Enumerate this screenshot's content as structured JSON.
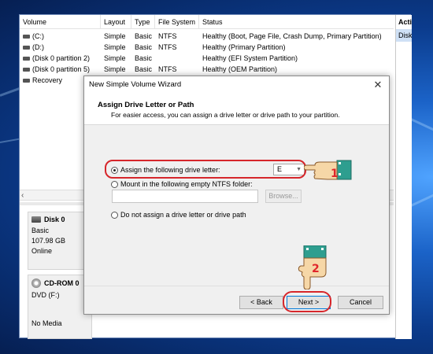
{
  "volume_list": {
    "columns": [
      "Volume",
      "Layout",
      "Type",
      "File System",
      "Status"
    ],
    "rows": [
      {
        "volume": "(C:)",
        "layout": "Simple",
        "type": "Basic",
        "fs": "NTFS",
        "status": "Healthy (Boot, Page File, Crash Dump, Primary Partition)"
      },
      {
        "volume": "(D:)",
        "layout": "Simple",
        "type": "Basic",
        "fs": "NTFS",
        "status": "Healthy (Primary Partition)"
      },
      {
        "volume": "(Disk 0 partition 2)",
        "layout": "Simple",
        "type": "Basic",
        "fs": "",
        "status": "Healthy (EFI System Partition)"
      },
      {
        "volume": "(Disk 0 partition 5)",
        "layout": "Simple",
        "type": "Basic",
        "fs": "NTFS",
        "status": "Healthy (OEM Partition)"
      },
      {
        "volume": "Recovery",
        "layout": "",
        "type": "",
        "fs": "",
        "status": ""
      }
    ]
  },
  "actions": {
    "title": "Acti",
    "item": "Disk"
  },
  "disks": [
    {
      "name": "Disk 0",
      "lines": [
        "Basic",
        "107.98 GB",
        "Online"
      ]
    },
    {
      "name": "CD-ROM 0",
      "lines": [
        "DVD (F:)",
        "",
        "No Media"
      ]
    }
  ],
  "wizard": {
    "title": "New Simple Volume Wizard",
    "heading": "Assign Drive Letter or Path",
    "subheading": "For easier access, you can assign a drive letter or drive path to your partition.",
    "option_assign": "Assign the following drive letter:",
    "drive_letter": "E",
    "option_mount": "Mount in the following empty NTFS folder:",
    "browse_label": "Browse...",
    "option_none": "Do not assign a drive letter or drive path",
    "back_label": "< Back",
    "next_label": "Next >",
    "cancel_label": "Cancel",
    "close_glyph": "✕"
  },
  "annotations": {
    "step1": "1",
    "step2": "2",
    "highlight_color": "#d6262b"
  }
}
